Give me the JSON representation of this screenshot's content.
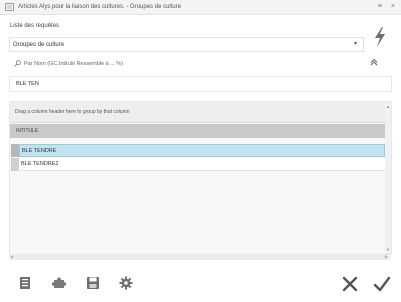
{
  "window": {
    "title": "Articles Alys pour la liaison des cultures. - Groupes de culture",
    "minimize_glyph": "≡",
    "close_glyph": "×"
  },
  "query": {
    "label": "Liste des requêtes",
    "selected": "Groupes de culture"
  },
  "search": {
    "hint": "Par Nom (GC.Intitulé Ressemble à ... %)",
    "value": "BLE TEN"
  },
  "grid": {
    "group_hint": "Drag a column header here to group by that column",
    "column_header": "INTITULE",
    "rows": [
      "BLE TENDRE",
      "BLE TENDRE2"
    ],
    "selected_index": 0
  },
  "colors": {
    "selected_row": "#bfe4f0",
    "header": "#c9c9c9",
    "icon_gray": "#6f6f6f"
  },
  "icons": {
    "bolt": "lightning-bolt-icon",
    "search": "search-icon",
    "collapse": "chevron-up-icon",
    "toolbar": [
      "document-icon",
      "puzzle-icon",
      "save-icon",
      "gear-icon"
    ],
    "actions": [
      "close-icon",
      "checkmark-icon"
    ]
  }
}
